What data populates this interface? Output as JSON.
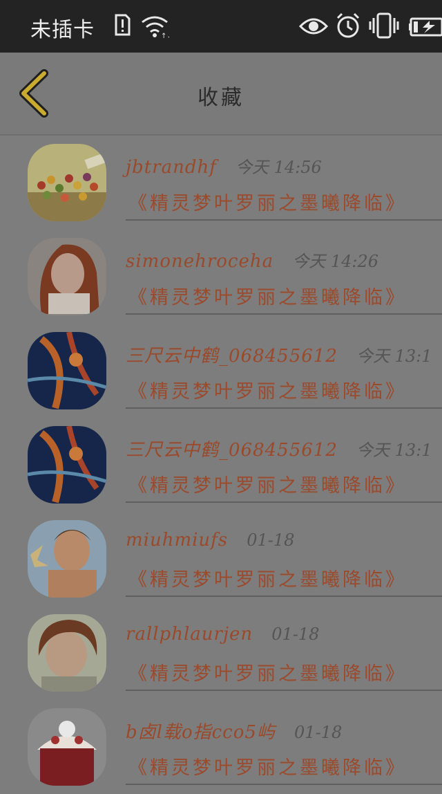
{
  "status_bar": {
    "carrier": "未插卡",
    "icons": [
      "sim-alert-icon",
      "wifi-icon",
      "eye-icon",
      "alarm-icon",
      "vibrate-icon",
      "battery-charging-icon"
    ]
  },
  "header": {
    "title": "收藏",
    "back_icon": "chevron-left-icon"
  },
  "colors": {
    "accent_back": "#c9ab2f",
    "username": "#9a4a2a",
    "title": "#9c4a2c"
  },
  "favorites": [
    {
      "username": "jbtrandhf",
      "time": "今天 14:56",
      "title": "《精灵梦叶罗丽之墨曦降临》"
    },
    {
      "username": "simonehroceha",
      "time": "今天 14:26",
      "title": "《精灵梦叶罗丽之墨曦降临》"
    },
    {
      "username": "三尺云中鹤_068455612",
      "time": "今天 13:1",
      "title": "《精灵梦叶罗丽之墨曦降临》"
    },
    {
      "username": "三尺云中鹤_068455612",
      "time": "今天 13:1",
      "title": "《精灵梦叶罗丽之墨曦降临》"
    },
    {
      "username": "miuhmiufs",
      "time": "01-18",
      "title": "《精灵梦叶罗丽之墨曦降临》"
    },
    {
      "username": "rallphlaurjen",
      "time": "01-18",
      "title": "《精灵梦叶罗丽之墨曦降临》"
    },
    {
      "username": "b卤l载o指cco5屿",
      "time": "01-18",
      "title": "《精灵梦叶罗丽之墨曦降临》"
    }
  ]
}
